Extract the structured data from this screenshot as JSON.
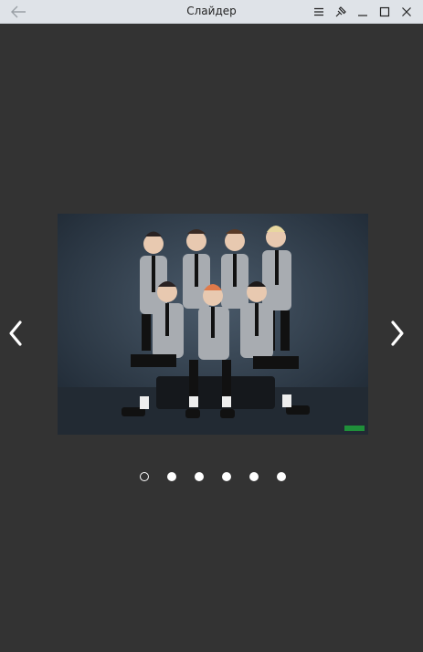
{
  "window": {
    "title": "Слайдер"
  },
  "slider": {
    "current_index": 1,
    "total": 6,
    "image_icon": "group-photo",
    "prev_icon": "chevron-left-icon",
    "next_icon": "chevron-right-icon",
    "active_dot_style": "hollow",
    "inactive_dot_style": "filled"
  },
  "colors": {
    "background": "#333333",
    "titlebar": "#dfe3e8",
    "accent": "#ffffff"
  }
}
